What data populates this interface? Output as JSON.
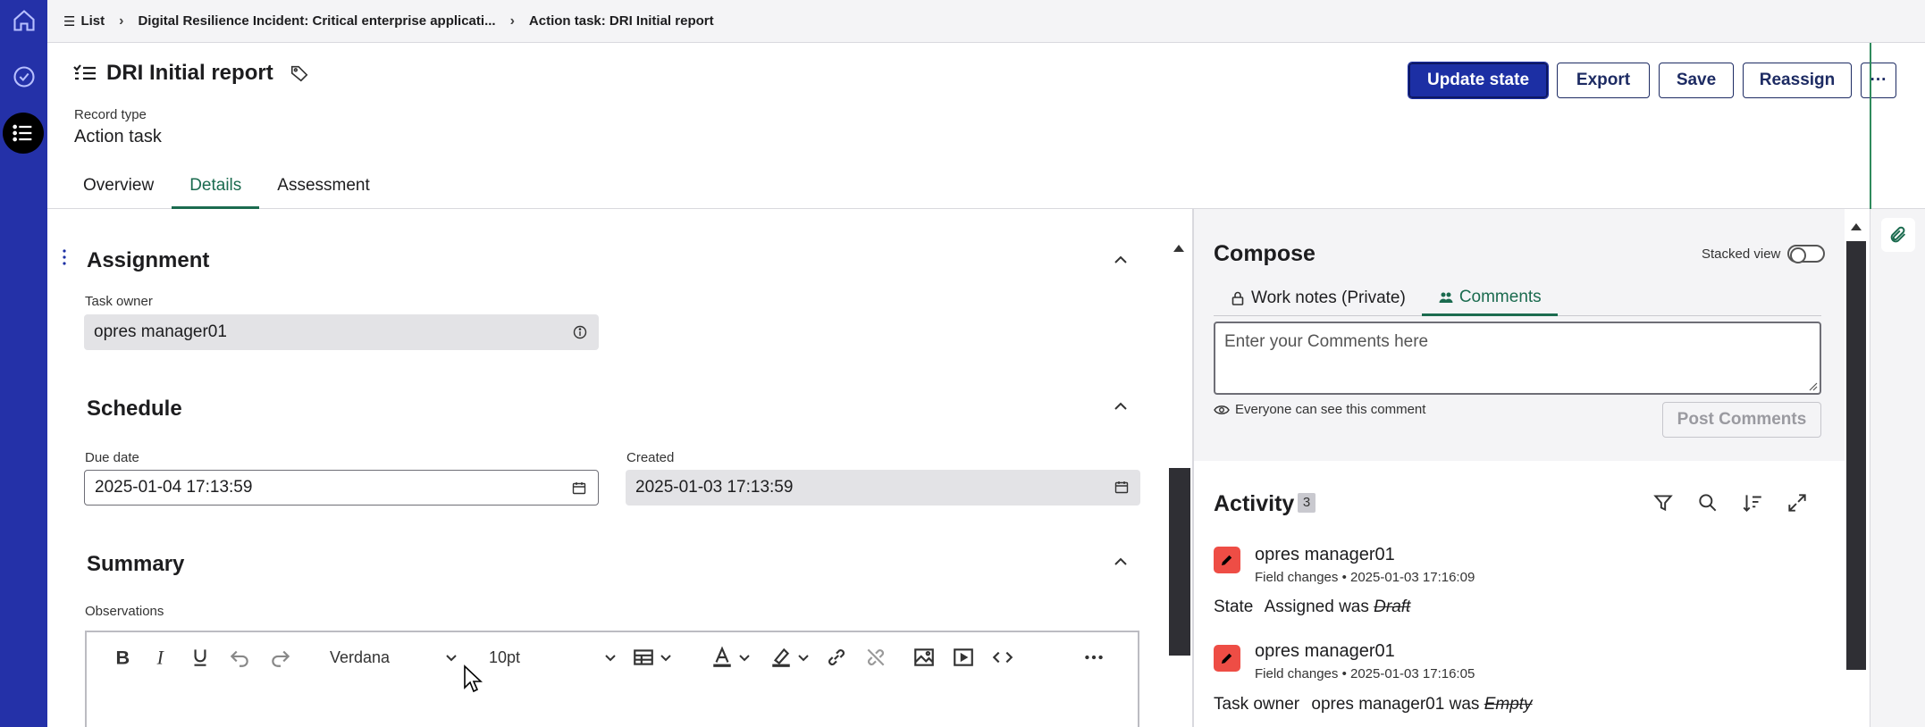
{
  "breadcrumb": {
    "items": [
      "List",
      "Digital Resilience Incident: Critical enterprise applicati...",
      "Action task: DRI Initial report"
    ]
  },
  "header": {
    "title": "DRI Initial report",
    "record_type_label": "Record type",
    "record_type_value": "Action task",
    "buttons": {
      "update_state": "Update state",
      "export": "Export",
      "save": "Save",
      "reassign": "Reassign",
      "more": "···"
    },
    "tabs": [
      "Overview",
      "Details",
      "Assessment"
    ],
    "active_tab": "Details"
  },
  "form": {
    "assignment": {
      "title": "Assignment",
      "task_owner_label": "Task owner",
      "task_owner_value": "opres manager01"
    },
    "schedule": {
      "title": "Schedule",
      "due_date_label": "Due date",
      "due_date_value": "2025-01-04 17:13:59",
      "created_label": "Created",
      "created_value": "2025-01-03 17:13:59"
    },
    "summary": {
      "title": "Summary",
      "observations_label": "Observations",
      "toolbar": {
        "font_family": "Verdana",
        "font_size": "10pt"
      }
    }
  },
  "compose": {
    "title": "Compose",
    "stacked_view_label": "Stacked view",
    "stacked_view_on": false,
    "tabs": [
      "Work notes (Private)",
      "Comments"
    ],
    "active_tab": "Comments",
    "comment_placeholder": "Enter your Comments here",
    "visibility_note": "Everyone can see this comment",
    "post_button": "Post Comments"
  },
  "activity": {
    "title": "Activity",
    "count": "3",
    "entries": [
      {
        "author": "opres manager01",
        "type": "Field changes",
        "timestamp": "2025-01-03 17:16:09",
        "field": "State",
        "new_value": "Assigned",
        "was_label": "was",
        "old_value": "Draft"
      },
      {
        "author": "opres manager01",
        "type": "Field changes",
        "timestamp": "2025-01-03 17:16:05",
        "field": "Task owner",
        "new_value": "opres manager01",
        "was_label": "was",
        "old_value": "Empty"
      }
    ]
  },
  "colors": {
    "rail": "#2431a8",
    "primary_button": "#1c2fa4",
    "active_tab": "#1b6b4f",
    "activity_avatar": "#ee4d45"
  },
  "icons": {
    "rail": [
      "home-icon",
      "check-circle-icon",
      "list-icon"
    ],
    "header": [
      "list-icon",
      "tag-icon"
    ],
    "activity_toolbar": [
      "filter-icon",
      "search-icon",
      "sort-icon",
      "expand-icon"
    ]
  }
}
